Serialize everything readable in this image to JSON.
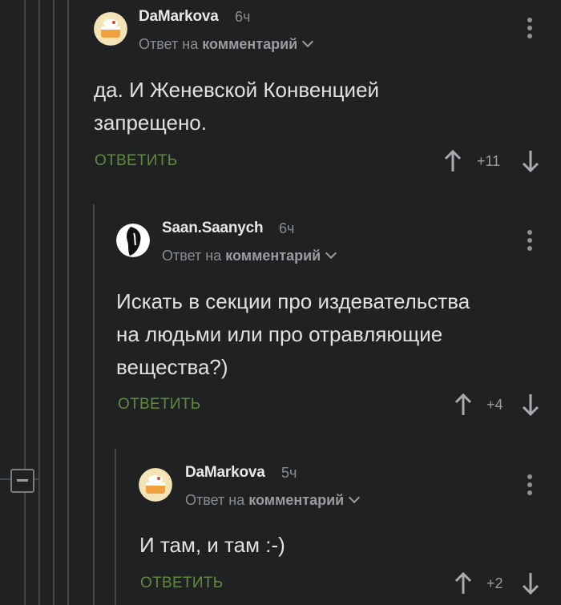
{
  "comments": [
    {
      "author": "DaMarkova",
      "time": "6ч",
      "reply_prefix": "Ответ на",
      "reply_target": "комментарий",
      "body_lines": [
        "да. И Женевской Конвенцией",
        "запрещено."
      ],
      "answer_label": "ОТВЕТИТЬ",
      "score": "+11",
      "avatar": "cake-avatar"
    },
    {
      "author": "Saan.Saanych",
      "time": "6ч",
      "reply_prefix": "Ответ на",
      "reply_target": "комментарий",
      "body_lines": [
        "Искать в секции про издевательства",
        "на людьми или про отравляющие",
        "вещества?)"
      ],
      "answer_label": "ОТВЕТИТЬ",
      "score": "+4",
      "avatar": "face-silhouette-avatar"
    },
    {
      "author": "DaMarkova",
      "time": "5ч",
      "reply_prefix": "Ответ на",
      "reply_target": "комментарий",
      "body_lines": [
        "И там, и там :-)"
      ],
      "answer_label": "ОТВЕТИТЬ",
      "score": "+2",
      "avatar": "cake-avatar"
    }
  ],
  "icons": {
    "upvote": "arrow-up-icon",
    "downvote": "arrow-down-icon",
    "more": "more-vertical-icon",
    "collapse": "collapse-thread-icon"
  },
  "colors": {
    "background": "#1f2123",
    "answer": "#5f8b3d",
    "thread_line": "#45484b"
  }
}
